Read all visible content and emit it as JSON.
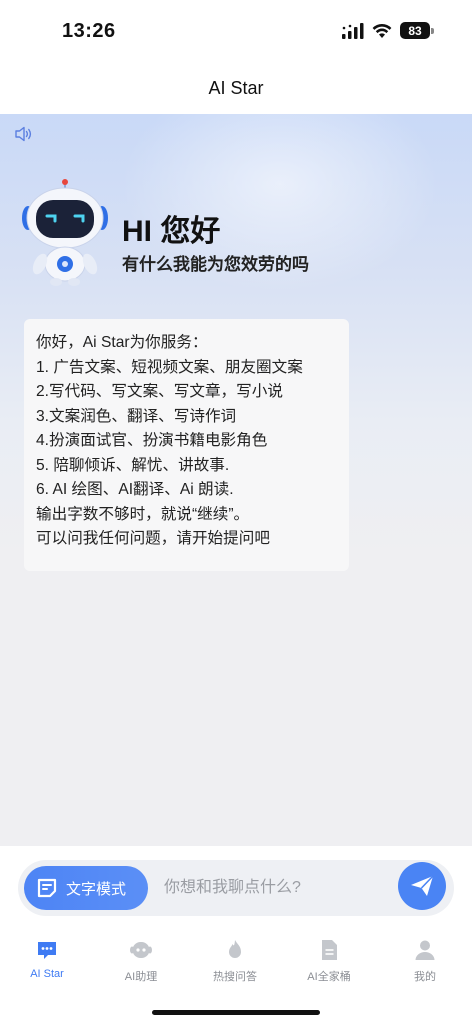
{
  "status_bar": {
    "time": "13:26",
    "battery": "83",
    "icons": [
      "signal-icon",
      "wifi-icon",
      "battery-icon"
    ]
  },
  "nav": {
    "title": "AI Star"
  },
  "hero": {
    "title": "HI 您好",
    "subtitle": "有什么我能为您效劳的吗"
  },
  "message": {
    "lines": [
      "你好，Ai Star为你服务：",
      "1. 广告文案、短视频文案、朋友圈文案",
      "2.写代码、写文案、写文章，写小说",
      "3.文案润色、翻译、写诗作词",
      "4.扮演面试官、扮演书籍电影角色",
      "5. 陪聊倾诉、解忧、讲故事.",
      "6. AI 绘图、AI翻译、Ai 朗读.",
      "输出字数不够时，就说“继续”。",
      "可以问我任何问题，请开始提问吧"
    ]
  },
  "input": {
    "mode_label": "文字模式",
    "placeholder": "你想和我聊点什么?",
    "value": ""
  },
  "tabs": [
    {
      "label": "AI Star",
      "icon": "chat-bubble-icon",
      "active": true
    },
    {
      "label": "AI助理",
      "icon": "robot-icon",
      "active": false
    },
    {
      "label": "热搜问答",
      "icon": "hot-icon",
      "active": false
    },
    {
      "label": "AI全家桶",
      "icon": "document-icon",
      "active": false
    },
    {
      "label": "我的",
      "icon": "user-icon",
      "active": false
    }
  ],
  "colors": {
    "accent": "#4a84f4",
    "tab_inactive": "#8b8e94",
    "card_bg": "#f7f7f8"
  }
}
